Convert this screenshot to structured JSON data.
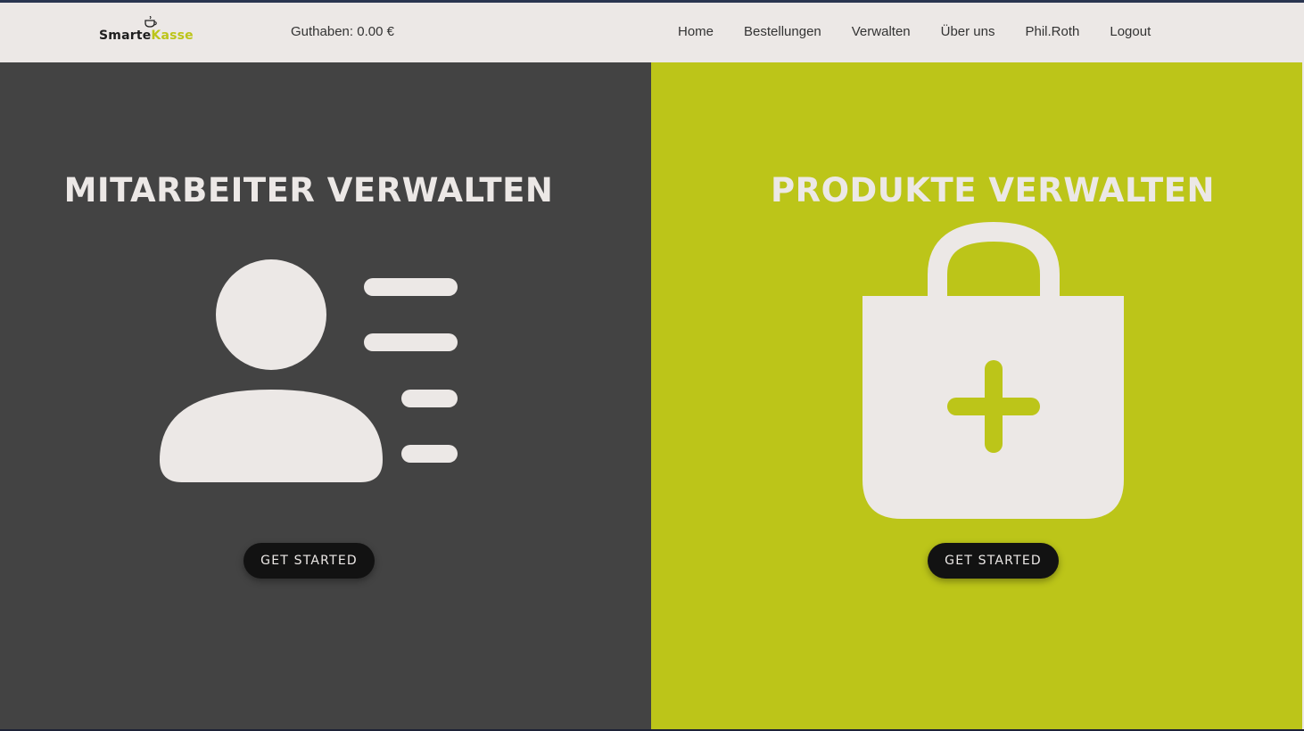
{
  "brand": {
    "name_part1": "Smarte",
    "name_part2": "Kasse",
    "logo_icon": "coffee-cup-icon",
    "accent_color": "#bcc519"
  },
  "header": {
    "balance": "Guthaben: 0.00 €",
    "nav": [
      {
        "label": "Home"
      },
      {
        "label": "Bestellungen"
      },
      {
        "label": "Verwalten"
      },
      {
        "label": "Über uns"
      },
      {
        "label": "Phil.Roth"
      },
      {
        "label": "Logout"
      }
    ]
  },
  "panels": {
    "employees": {
      "title": "MITARBEITER VERWALTEN",
      "icon": "user-list-icon",
      "button": "GET STARTED",
      "background": "#434343"
    },
    "products": {
      "title": "PRODUKTE VERWALTEN",
      "icon": "shopping-bag-add-icon",
      "button": "GET STARTED",
      "background": "#bcc519"
    }
  }
}
